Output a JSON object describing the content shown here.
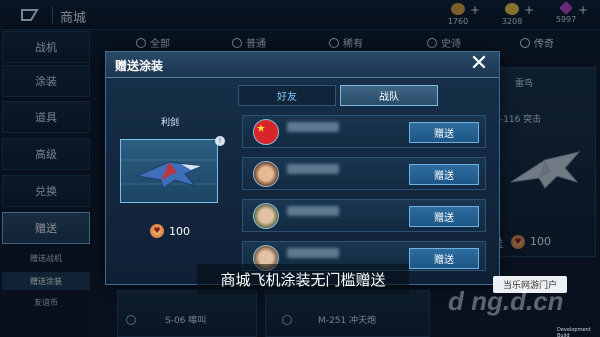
{
  "app": {
    "title": "商城"
  },
  "currencies": [
    {
      "amount": "1760",
      "color": "#e0a542"
    },
    {
      "amount": "3208",
      "color": "#f0c649"
    },
    {
      "amount": "5997",
      "color": "#c046c9"
    }
  ],
  "sidebar": {
    "items": [
      {
        "label": "战机"
      },
      {
        "label": "涂装"
      },
      {
        "label": "道具"
      },
      {
        "label": "高级"
      },
      {
        "label": "兑换"
      },
      {
        "label": "赠送"
      }
    ],
    "subitems": [
      {
        "label": "赠送战机"
      },
      {
        "label": "赠送涂装"
      },
      {
        "label": "友谊币"
      }
    ]
  },
  "category_tabs": [
    {
      "label": "全部"
    },
    {
      "label": "普通"
    },
    {
      "label": "稀有"
    },
    {
      "label": "史诗"
    },
    {
      "label": "传奇"
    }
  ],
  "background_cards": [
    {
      "title": "雷鸟",
      "subtitle": "A-116 突击"
    },
    {
      "title": "S-06 嗥叫"
    },
    {
      "title": "M-251 冲天炮"
    }
  ],
  "background_price": {
    "label": "送",
    "value": "100"
  },
  "modal": {
    "title": "赠送涂装",
    "close_symbol": "✕",
    "skin_name": "利剑",
    "price": "100",
    "tabs": [
      {
        "label": "好友"
      },
      {
        "label": "战队"
      }
    ],
    "friends": [
      {
        "button": "赠送"
      },
      {
        "button": "赠送"
      },
      {
        "button": "赠送"
      },
      {
        "button": "赠送"
      }
    ]
  },
  "caption": "商城飞机涂装无门槛赠送",
  "sign": "当乐网游门户",
  "watermark": "d ng.d.cn",
  "dev_build": "Development Build"
}
